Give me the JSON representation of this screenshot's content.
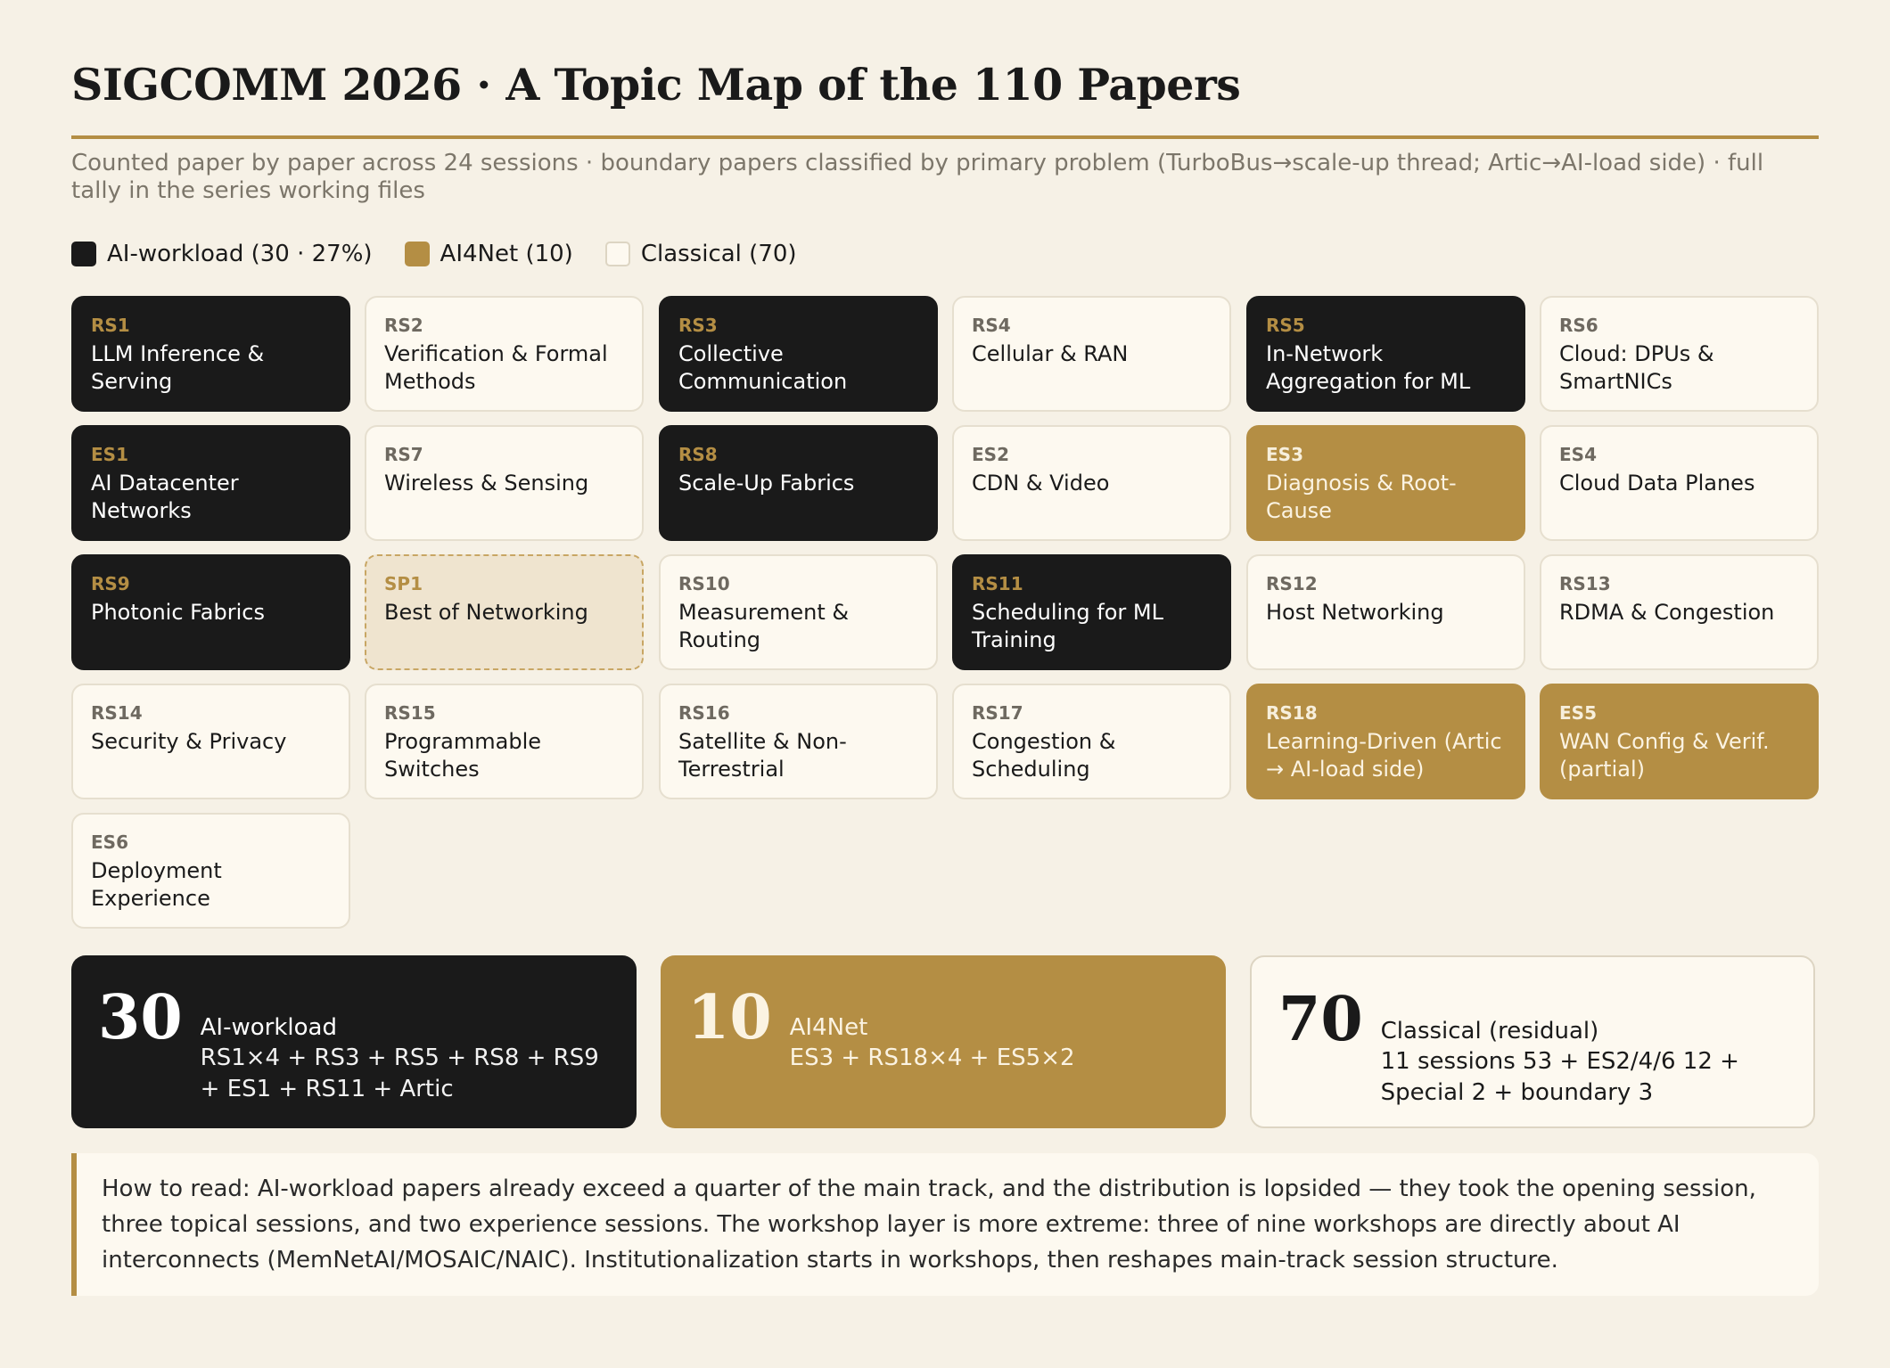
{
  "header": {
    "title": "SIGCOMM 2026 · A Topic Map of the 110 Papers",
    "subtitle": "Counted paper by paper across 24 sessions · boundary papers classified by primary problem (TurboBus→scale-up thread; Artic→AI-load side) · full tally in the series working files"
  },
  "legend": [
    {
      "label": "AI-workload (30 · 27%)",
      "kind": "ai"
    },
    {
      "label": "AI4Net (10)",
      "kind": "ai4net"
    },
    {
      "label": "Classical (70)",
      "kind": "classical"
    }
  ],
  "colors": {
    "ai": "#1a1a1a",
    "ai4net": "#b48e44",
    "classical": "#fdf9f0",
    "background": "#f6f1e6"
  },
  "sessions": [
    {
      "code": "RS1",
      "name": "LLM Inference & Serving",
      "kind": "ai"
    },
    {
      "code": "RS2",
      "name": "Verification & Formal Methods",
      "kind": "classical"
    },
    {
      "code": "RS3",
      "name": "Collective Communication",
      "kind": "ai"
    },
    {
      "code": "RS4",
      "name": "Cellular & RAN",
      "kind": "classical"
    },
    {
      "code": "RS5",
      "name": "In-Network Aggregation for ML",
      "kind": "ai"
    },
    {
      "code": "RS6",
      "name": "Cloud: DPUs & SmartNICs",
      "kind": "classical"
    },
    {
      "code": "ES1",
      "name": "AI Datacenter Networks",
      "kind": "ai"
    },
    {
      "code": "RS7",
      "name": "Wireless & Sensing",
      "kind": "classical"
    },
    {
      "code": "RS8",
      "name": "Scale-Up Fabrics",
      "kind": "ai"
    },
    {
      "code": "ES2",
      "name": "CDN & Video",
      "kind": "classical"
    },
    {
      "code": "ES3",
      "name": "Diagnosis & Root-Cause",
      "kind": "ai4net"
    },
    {
      "code": "ES4",
      "name": "Cloud Data Planes",
      "kind": "classical"
    },
    {
      "code": "RS9",
      "name": "Photonic Fabrics",
      "kind": "ai"
    },
    {
      "code": "SP1",
      "name": "Best of Networking",
      "kind": "special"
    },
    {
      "code": "RS10",
      "name": "Measurement & Routing",
      "kind": "classical"
    },
    {
      "code": "RS11",
      "name": "Scheduling for ML Training",
      "kind": "ai"
    },
    {
      "code": "RS12",
      "name": "Host Networking",
      "kind": "classical"
    },
    {
      "code": "RS13",
      "name": "RDMA & Congestion",
      "kind": "classical"
    },
    {
      "code": "RS14",
      "name": "Security & Privacy",
      "kind": "classical"
    },
    {
      "code": "RS15",
      "name": "Programmable Switches",
      "kind": "classical"
    },
    {
      "code": "RS16",
      "name": "Satellite & Non-Terrestrial",
      "kind": "classical"
    },
    {
      "code": "RS17",
      "name": "Congestion & Scheduling",
      "kind": "classical"
    },
    {
      "code": "RS18",
      "name": "Learning-Driven (Artic → AI-load side)",
      "kind": "ai4net"
    },
    {
      "code": "ES5",
      "name": "WAN Config & Verif. (partial)",
      "kind": "ai4net"
    },
    {
      "code": "ES6",
      "name": "Deployment Experience",
      "kind": "classical"
    }
  ],
  "summary": {
    "ai": {
      "count": "30",
      "label": "AI-workload",
      "detail": "RS1×4 + RS3 + RS5 + RS8 + RS9 + ES1 + RS11 + Artic"
    },
    "ai4net": {
      "count": "10",
      "label": "AI4Net",
      "detail": "ES3 + RS18×4 + ES5×2"
    },
    "classical": {
      "count": "70",
      "label": "Classical (residual)",
      "detail": "11 sessions 53 + ES2/4/6 12 + Special 2 + boundary 3"
    }
  },
  "note": "How to read: AI-workload papers already exceed a quarter of the main track, and the distribution is lopsided — they took the opening session, three topical sessions, and two experience sessions. The workshop layer is more extreme: three of nine workshops are directly about AI interconnects (MemNetAI/MOSAIC/NAIC). Institutionalization starts in workshops, then reshapes main-track session structure."
}
